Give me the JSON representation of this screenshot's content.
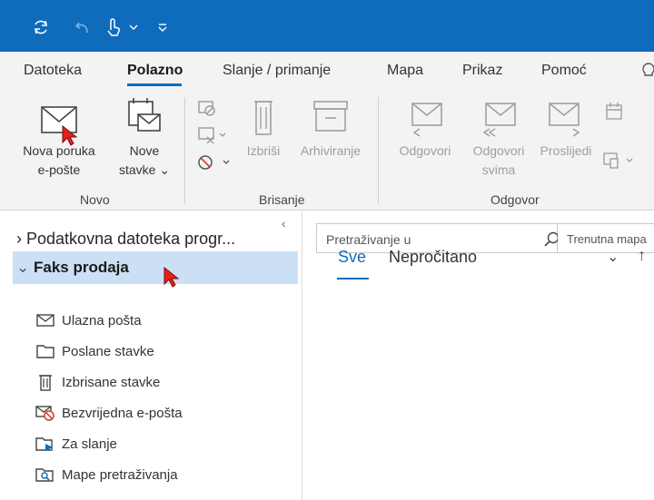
{
  "tabs": [
    {
      "label": "Datoteka"
    },
    {
      "label": "Polazno"
    },
    {
      "label": "Slanje / primanje"
    },
    {
      "label": "Mapa"
    },
    {
      "label": "Prikaz"
    },
    {
      "label": "Pomoć"
    }
  ],
  "active_tab": "Polazno",
  "ribbon": {
    "new_email": [
      "Nova poruka",
      "e-pošte"
    ],
    "new_items": [
      "Nove",
      "stavke"
    ],
    "delete": "Izbriši",
    "archive": "Arhiviranje",
    "reply": "Odgovori",
    "reply_all": [
      "Odgovori",
      "svima"
    ],
    "forward": "Proslijedi",
    "groups": {
      "novo": "Novo",
      "brisanje": "Brisanje",
      "odgovor": "Odgovor"
    }
  },
  "folder_pane": {
    "data_file": "Podatkovna datoteka progr...",
    "account": "Faks prodaja",
    "folders": [
      {
        "name": "Ulazna pošta",
        "icon": "inbox-icon"
      },
      {
        "name": "Poslane stavke",
        "icon": "sent-items-icon"
      },
      {
        "name": "Izbrisane stavke",
        "icon": "deleted-items-icon"
      },
      {
        "name": "Bezvrijedna e-pošta",
        "icon": "junk-email-icon"
      },
      {
        "name": "Za slanje",
        "icon": "outbox-icon"
      },
      {
        "name": "Mape pretraživanja",
        "icon": "search-folders-icon"
      }
    ]
  },
  "message_list": {
    "search_placeholder": "Pretraživanje u",
    "search_scope": "Trenutna mapa",
    "filter_all": "Sve",
    "filter_unread": "Nepročitano"
  },
  "colors": {
    "accent": "#0f6cbd",
    "selection": "#cce0f5",
    "cursor": "#e8211b"
  }
}
